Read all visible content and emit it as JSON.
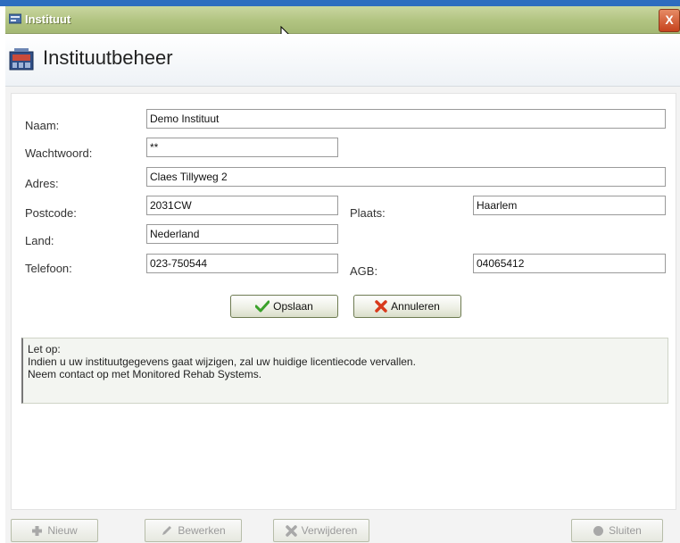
{
  "window": {
    "title": "Instituut",
    "close_label": "X"
  },
  "header": {
    "title": "Instituutbeheer"
  },
  "form": {
    "naam": {
      "label": "Naam:",
      "value": "Demo Instituut"
    },
    "wachtwoord": {
      "label": "Wachtwoord:",
      "value": "**"
    },
    "adres": {
      "label": "Adres:",
      "value": "Claes Tillyweg 2"
    },
    "postcode": {
      "label": "Postcode:",
      "value": "2031CW"
    },
    "plaats": {
      "label": "Plaats:",
      "value": "Haarlem"
    },
    "land": {
      "label": "Land:",
      "value": "Nederland"
    },
    "telefoon": {
      "label": "Telefoon:",
      "value": "023-750544"
    },
    "agb": {
      "label": "AGB:",
      "value": "04065412"
    }
  },
  "actions": {
    "save_label": "Opslaan",
    "cancel_label": "Annuleren"
  },
  "note": {
    "lines": [
      "Let op:",
      "Indien u uw instituutgegevens gaat wijzigen, zal uw huidige licentiecode vervallen.",
      "Neem contact op met Monitored Rehab Systems."
    ]
  },
  "toolbar": {
    "new_label": "Nieuw",
    "edit_label": "Bewerken",
    "delete_label": "Verwijderen",
    "close_label": "Sluiten"
  },
  "icons": {
    "title": "window-icon",
    "header": "institute-icon",
    "save": "checkmark-icon",
    "cancel": "cross-icon",
    "new": "plus-icon",
    "edit": "pencil-icon",
    "delete": "cross-icon",
    "close": "circle-icon"
  },
  "colors": {
    "titlebar": "#b3c583",
    "close_button": "#c6431d",
    "check": "#3aa12a",
    "cross": "#d83a1c"
  }
}
